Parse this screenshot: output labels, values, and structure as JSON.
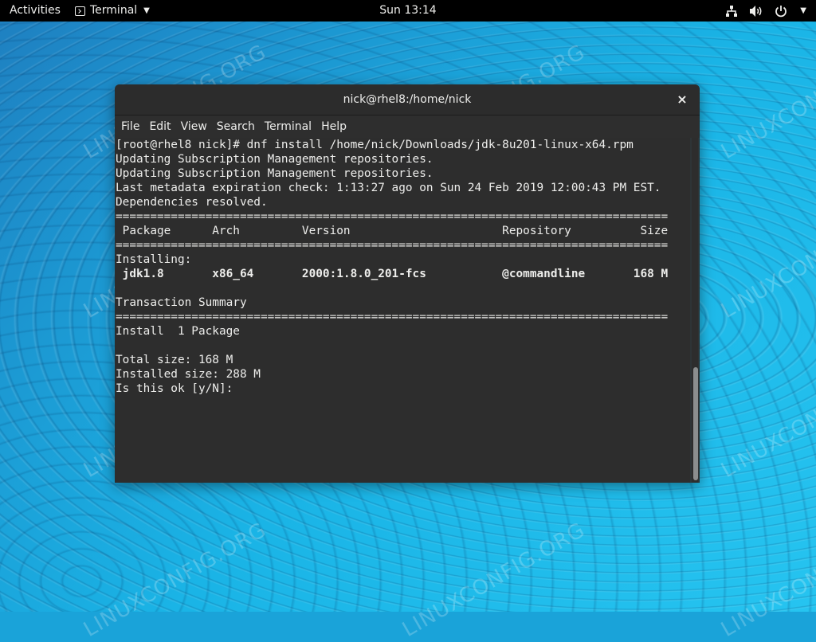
{
  "topbar": {
    "activities": "Activities",
    "app_name": "Terminal",
    "clock": "Sun 13:14",
    "icons": [
      "network-icon",
      "volume-icon",
      "power-icon",
      "chevron-down-icon"
    ]
  },
  "watermark_text": "LINUXCONFIG.ORG",
  "window": {
    "title": "nick@rhel8:/home/nick",
    "close_label": "×",
    "menu": [
      "File",
      "Edit",
      "View",
      "Search",
      "Terminal",
      "Help"
    ]
  },
  "terminal": {
    "lines": [
      "[root@rhel8 nick]# dnf install /home/nick/Downloads/jdk-8u201-linux-x64.rpm",
      "Updating Subscription Management repositories.",
      "Updating Subscription Management repositories.",
      "Last metadata expiration check: 1:13:27 ago on Sun 24 Feb 2019 12:00:43 PM EST.",
      "Dependencies resolved.",
      "================================================================================",
      " Package      Arch         Version                      Repository          Size",
      "================================================================================",
      "Installing:",
      " jdk1.8       x86_64       2000:1.8.0_201-fcs           @commandline       168 M",
      "",
      "Transaction Summary",
      "================================================================================",
      "Install  1 Package",
      "",
      "Total size: 168 M",
      "Installed size: 288 M",
      "Is this ok [y/N]: "
    ]
  },
  "colors": {
    "topbar_bg": "#000000",
    "terminal_bg": "#2d2d2d",
    "terminal_fg": "#eeeeec",
    "titlebar_bg": "#2c2c2c"
  }
}
